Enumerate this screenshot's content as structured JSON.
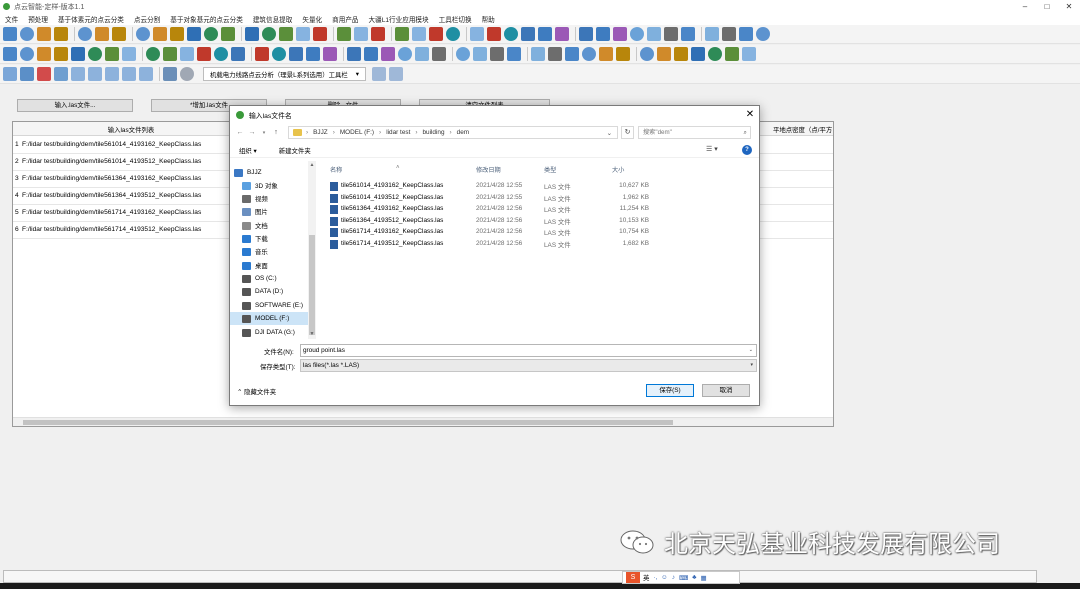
{
  "window": {
    "title": "点云智能-定样-版本1.1"
  },
  "menu": [
    "文件",
    "预处理",
    "基于体素元的点云分类",
    "点云分割",
    "基于对象基元的点云分类",
    "建筑信息提取",
    "矢量化",
    "商用产品",
    "大疆L1行业应用模块",
    "工具栏切换",
    "帮助"
  ],
  "toolbar3": {
    "combo_label": "机载电力线路点云分析（理景L系列选用）工具栏"
  },
  "workspace": {
    "buttons": [
      "输入.las文件...",
      "*增加.las文件",
      "删除...文件",
      "清空文件列表"
    ],
    "grid_header": "输入las文件列表",
    "grid_header_right": "平地点密度（点/平方",
    "rows": [
      {
        "n": "1",
        "path": "F:/lidar test/building/dem/tile561014_4193162_KeepClass.las"
      },
      {
        "n": "2",
        "path": "F:/lidar test/building/dem/tile561014_4193512_KeepClass.las"
      },
      {
        "n": "3",
        "path": "F:/lidar test/building/dem/tile561364_4193162_KeepClass.las"
      },
      {
        "n": "4",
        "path": "F:/lidar test/building/dem/tile561364_4193512_KeepClass.las"
      },
      {
        "n": "5",
        "path": "F:/lidar test/building/dem/tile561714_4193162_KeepClass.las"
      },
      {
        "n": "6",
        "path": "F:/lidar test/building/dem/tile561714_4193512_KeepClass.las"
      }
    ]
  },
  "dialog": {
    "title": "输入las文件名",
    "breadcrumb": [
      "BJJZ",
      "MODEL (F:)",
      "lidar test",
      "building",
      "dem"
    ],
    "search_placeholder": "搜索\"dem\"",
    "organize": "组织 ▾",
    "new_folder": "新建文件夹",
    "nav": [
      {
        "label": "BJJZ",
        "icon": "computer-icon",
        "color": "#3b78c4"
      },
      {
        "label": "3D 对象",
        "icon": "3d-objects-icon",
        "color": "#5aa0e0"
      },
      {
        "label": "视频",
        "icon": "video-icon",
        "color": "#6a6a6a"
      },
      {
        "label": "图片",
        "icon": "pictures-icon",
        "color": "#6a8fc0"
      },
      {
        "label": "文档",
        "icon": "documents-icon",
        "color": "#8a8a8a"
      },
      {
        "label": "下载",
        "icon": "downloads-icon",
        "color": "#2a7ad0"
      },
      {
        "label": "音乐",
        "icon": "music-icon",
        "color": "#2a7ad0"
      },
      {
        "label": "桌面",
        "icon": "desktop-icon",
        "color": "#2a7ad0"
      },
      {
        "label": "OS (C:)",
        "icon": "drive-icon",
        "color": "#555555"
      },
      {
        "label": "DATA (D:)",
        "icon": "drive-icon",
        "color": "#555555"
      },
      {
        "label": "SOFTWARE (E:)",
        "icon": "drive-icon",
        "color": "#555555"
      },
      {
        "label": "MODEL (F:)",
        "icon": "drive-icon",
        "color": "#555555"
      },
      {
        "label": "DJI DATA (G:)",
        "icon": "drive-icon",
        "color": "#555555"
      }
    ],
    "columns": [
      "名称",
      "修改日期",
      "类型",
      "大小"
    ],
    "files": [
      {
        "name": "tile561014_4193162_KeepClass.las",
        "date": "2021/4/28 12:55",
        "type": "LAS 文件",
        "size": "10,627 KB"
      },
      {
        "name": "tile561014_4193512_KeepClass.las",
        "date": "2021/4/28 12:55",
        "type": "LAS 文件",
        "size": "1,962 KB"
      },
      {
        "name": "tile561364_4193162_KeepClass.las",
        "date": "2021/4/28 12:56",
        "type": "LAS 文件",
        "size": "11,254 KB"
      },
      {
        "name": "tile561364_4193512_KeepClass.las",
        "date": "2021/4/28 12:56",
        "type": "LAS 文件",
        "size": "10,153 KB"
      },
      {
        "name": "tile561714_4193162_KeepClass.las",
        "date": "2021/4/28 12:56",
        "type": "LAS 文件",
        "size": "10,754 KB"
      },
      {
        "name": "tile561714_4193512_KeepClass.las",
        "date": "2021/4/28 12:56",
        "type": "LAS 文件",
        "size": "1,682 KB"
      }
    ],
    "filename_label": "文件名(N):",
    "filename_value": "groud point.las",
    "filetype_label": "保存类型(T):",
    "filetype_value": "las files(*.las *.LAS)",
    "hide_folders": "隐藏文件夹",
    "save": "保存(S)",
    "cancel": "取消"
  },
  "ime": {
    "logo": "S",
    "mode": "英"
  },
  "watermark": "北京天弘基业科技发展有限公司",
  "colors": {
    "accent": "#0078d7",
    "selected": "#cce4f7"
  }
}
